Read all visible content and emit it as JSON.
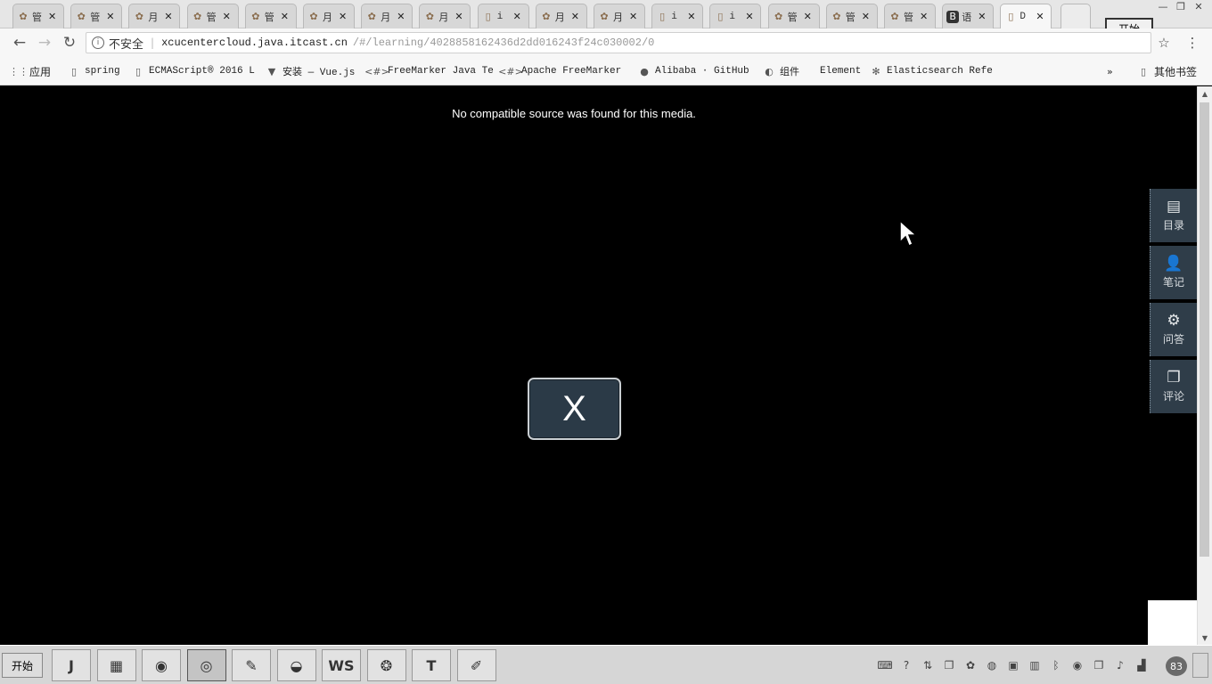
{
  "window": {
    "start_popup_label": "开始",
    "controls": {
      "minimize": "—",
      "restore": "❐",
      "close": "✕"
    }
  },
  "tabs": [
    {
      "icon": "huawei-icon",
      "glyph": "✿",
      "label": "管"
    },
    {
      "icon": "huawei-icon",
      "glyph": "✿",
      "label": "管"
    },
    {
      "icon": "huawei-icon",
      "glyph": "✿",
      "label": "月"
    },
    {
      "icon": "huawei-icon",
      "glyph": "✿",
      "label": "管"
    },
    {
      "icon": "huawei-icon",
      "glyph": "✿",
      "label": "管"
    },
    {
      "icon": "huawei-icon",
      "glyph": "✿",
      "label": "月"
    },
    {
      "icon": "huawei-icon",
      "glyph": "✿",
      "label": "月"
    },
    {
      "icon": "huawei-icon",
      "glyph": "✿",
      "label": "月"
    },
    {
      "icon": "page-icon",
      "glyph": "▯",
      "label": "i"
    },
    {
      "icon": "huawei-icon",
      "glyph": "✿",
      "label": "月"
    },
    {
      "icon": "huawei-icon",
      "glyph": "✿",
      "label": "月"
    },
    {
      "icon": "page-icon",
      "glyph": "▯",
      "label": "i"
    },
    {
      "icon": "page-icon",
      "glyph": "▯",
      "label": "i"
    },
    {
      "icon": "huawei-icon",
      "glyph": "✿",
      "label": "管"
    },
    {
      "icon": "huawei-icon",
      "glyph": "✿",
      "label": "管"
    },
    {
      "icon": "huawei-icon",
      "glyph": "✿",
      "label": "管"
    },
    {
      "icon": "bilibili-icon",
      "glyph": "B",
      "label": "语"
    },
    {
      "icon": "page-icon",
      "glyph": "▯",
      "label": "D",
      "active": true
    }
  ],
  "tab_close_glyph": "✕",
  "nav": {
    "back": "←",
    "forward": "→",
    "reload": "↻"
  },
  "address": {
    "info_glyph": "i",
    "security_label": "不安全",
    "host": "xcucentercloud.java.itcast.cn",
    "path": "/#/learning/4028858162436d2dd016243f24c030002/0"
  },
  "star_glyph": "☆",
  "menu_glyph": "⋮",
  "bookmarks": [
    {
      "name": "bookmark-apps",
      "icon": "apps-grid-icon",
      "glyph": "⋮⋮",
      "label": "应用",
      "cjk": true
    },
    {
      "name": "bookmark-spring",
      "icon": "page-icon",
      "glyph": "▯",
      "label": "spring"
    },
    {
      "name": "bookmark-ecmascript",
      "icon": "page-icon",
      "glyph": "▯",
      "label": "ECMAScript® 2016 L"
    },
    {
      "name": "bookmark-vue",
      "icon": "vue-icon",
      "glyph": "▼",
      "label": "安装 — Vue.js"
    },
    {
      "name": "bookmark-freemarker-java",
      "icon": "freemarker-icon",
      "glyph": "<#>",
      "label": "FreeMarker Java Te"
    },
    {
      "name": "bookmark-apache-freemarker",
      "icon": "freemarker-icon",
      "glyph": "<#>",
      "label": "Apache FreeMarker"
    },
    {
      "name": "bookmark-github",
      "icon": "github-icon",
      "glyph": "●",
      "label": "Alibaba · GitHub"
    },
    {
      "name": "bookmark-components",
      "icon": "element-icon",
      "glyph": "◐",
      "label": "组件"
    },
    {
      "name": "bookmark-element",
      "icon": "element-icon",
      "glyph": "",
      "label": "Element"
    },
    {
      "name": "bookmark-elasticsearch",
      "icon": "elasticsearch-icon",
      "glyph": "✻",
      "label": "Elasticsearch Refe"
    }
  ],
  "bookmarks_overflow": "»",
  "other_bookmarks": {
    "glyph": "▯",
    "label": "其他书签"
  },
  "media": {
    "message": "No compatible source was found for this media.",
    "close_label": "X"
  },
  "side_panel": [
    {
      "name": "side-catalog-button",
      "icon": "catalog-icon",
      "glyph": "▤",
      "label": "目录"
    },
    {
      "name": "side-notes-button",
      "icon": "user-icon",
      "glyph": "👤",
      "label": "笔记"
    },
    {
      "name": "side-qa-button",
      "icon": "gear-icon",
      "glyph": "⚙",
      "label": "问答"
    },
    {
      "name": "side-comments-button",
      "icon": "clipboard-icon",
      "glyph": "❐",
      "label": "评论"
    }
  ],
  "scrollbar": {
    "up": "▲",
    "down": "▼"
  },
  "taskbar": {
    "start_label": "开始",
    "apps": [
      {
        "name": "taskbar-intellij",
        "icon": "intellij-icon",
        "glyph": "J"
      },
      {
        "name": "taskbar-files",
        "icon": "folder-icon",
        "glyph": "▦"
      },
      {
        "name": "taskbar-app-3",
        "icon": "app-icon",
        "glyph": "◉"
      },
      {
        "name": "taskbar-chrome",
        "icon": "chrome-icon",
        "glyph": "◎",
        "pressed": true
      },
      {
        "name": "taskbar-app-5",
        "icon": "tool-icon",
        "glyph": "✎"
      },
      {
        "name": "taskbar-app-6",
        "icon": "turtle-icon",
        "glyph": "◒"
      },
      {
        "name": "taskbar-webstorm",
        "icon": "webstorm-icon",
        "glyph": "WS"
      },
      {
        "name": "taskbar-app-8",
        "icon": "swirl-icon",
        "glyph": "❂"
      },
      {
        "name": "taskbar-typora",
        "icon": "text-icon",
        "glyph": "T"
      },
      {
        "name": "taskbar-app-10",
        "icon": "pen-icon",
        "glyph": "✐"
      }
    ],
    "tray_icons": [
      {
        "icon": "keyboard-icon",
        "glyph": "⌨"
      },
      {
        "icon": "help-icon",
        "glyph": "?"
      },
      {
        "icon": "network-icon",
        "glyph": "⇅"
      },
      {
        "icon": "window-icon",
        "glyph": "❐"
      },
      {
        "icon": "app-tray-icon",
        "glyph": "✿"
      },
      {
        "icon": "app-tray-icon",
        "glyph": "◍"
      },
      {
        "icon": "nvidia-icon",
        "glyph": "▣"
      },
      {
        "icon": "app-tray-icon",
        "glyph": "▥"
      },
      {
        "icon": "bluetooth-icon",
        "glyph": "ᛒ"
      },
      {
        "icon": "app-tray-icon",
        "glyph": "◉"
      },
      {
        "icon": "clipboard-icon",
        "glyph": "❐"
      },
      {
        "icon": "volume-icon",
        "glyph": "♪"
      },
      {
        "icon": "signal-icon",
        "glyph": "▟"
      }
    ],
    "badge": "83"
  }
}
